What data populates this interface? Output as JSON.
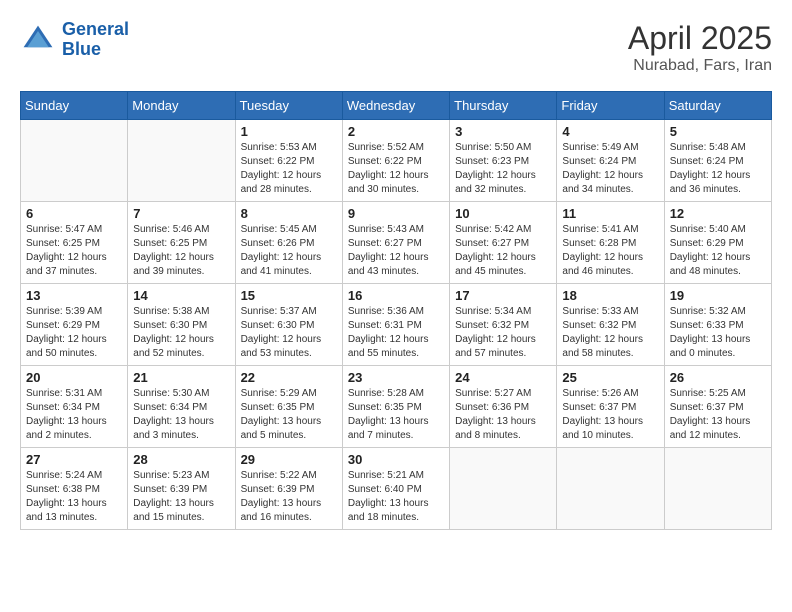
{
  "header": {
    "logo_line1": "General",
    "logo_line2": "Blue",
    "title": "April 2025",
    "subtitle": "Nurabad, Fars, Iran"
  },
  "days_of_week": [
    "Sunday",
    "Monday",
    "Tuesday",
    "Wednesday",
    "Thursday",
    "Friday",
    "Saturday"
  ],
  "weeks": [
    [
      {
        "day": "",
        "info": ""
      },
      {
        "day": "",
        "info": ""
      },
      {
        "day": "1",
        "info": "Sunrise: 5:53 AM\nSunset: 6:22 PM\nDaylight: 12 hours\nand 28 minutes."
      },
      {
        "day": "2",
        "info": "Sunrise: 5:52 AM\nSunset: 6:22 PM\nDaylight: 12 hours\nand 30 minutes."
      },
      {
        "day": "3",
        "info": "Sunrise: 5:50 AM\nSunset: 6:23 PM\nDaylight: 12 hours\nand 32 minutes."
      },
      {
        "day": "4",
        "info": "Sunrise: 5:49 AM\nSunset: 6:24 PM\nDaylight: 12 hours\nand 34 minutes."
      },
      {
        "day": "5",
        "info": "Sunrise: 5:48 AM\nSunset: 6:24 PM\nDaylight: 12 hours\nand 36 minutes."
      }
    ],
    [
      {
        "day": "6",
        "info": "Sunrise: 5:47 AM\nSunset: 6:25 PM\nDaylight: 12 hours\nand 37 minutes."
      },
      {
        "day": "7",
        "info": "Sunrise: 5:46 AM\nSunset: 6:25 PM\nDaylight: 12 hours\nand 39 minutes."
      },
      {
        "day": "8",
        "info": "Sunrise: 5:45 AM\nSunset: 6:26 PM\nDaylight: 12 hours\nand 41 minutes."
      },
      {
        "day": "9",
        "info": "Sunrise: 5:43 AM\nSunset: 6:27 PM\nDaylight: 12 hours\nand 43 minutes."
      },
      {
        "day": "10",
        "info": "Sunrise: 5:42 AM\nSunset: 6:27 PM\nDaylight: 12 hours\nand 45 minutes."
      },
      {
        "day": "11",
        "info": "Sunrise: 5:41 AM\nSunset: 6:28 PM\nDaylight: 12 hours\nand 46 minutes."
      },
      {
        "day": "12",
        "info": "Sunrise: 5:40 AM\nSunset: 6:29 PM\nDaylight: 12 hours\nand 48 minutes."
      }
    ],
    [
      {
        "day": "13",
        "info": "Sunrise: 5:39 AM\nSunset: 6:29 PM\nDaylight: 12 hours\nand 50 minutes."
      },
      {
        "day": "14",
        "info": "Sunrise: 5:38 AM\nSunset: 6:30 PM\nDaylight: 12 hours\nand 52 minutes."
      },
      {
        "day": "15",
        "info": "Sunrise: 5:37 AM\nSunset: 6:30 PM\nDaylight: 12 hours\nand 53 minutes."
      },
      {
        "day": "16",
        "info": "Sunrise: 5:36 AM\nSunset: 6:31 PM\nDaylight: 12 hours\nand 55 minutes."
      },
      {
        "day": "17",
        "info": "Sunrise: 5:34 AM\nSunset: 6:32 PM\nDaylight: 12 hours\nand 57 minutes."
      },
      {
        "day": "18",
        "info": "Sunrise: 5:33 AM\nSunset: 6:32 PM\nDaylight: 12 hours\nand 58 minutes."
      },
      {
        "day": "19",
        "info": "Sunrise: 5:32 AM\nSunset: 6:33 PM\nDaylight: 13 hours\nand 0 minutes."
      }
    ],
    [
      {
        "day": "20",
        "info": "Sunrise: 5:31 AM\nSunset: 6:34 PM\nDaylight: 13 hours\nand 2 minutes."
      },
      {
        "day": "21",
        "info": "Sunrise: 5:30 AM\nSunset: 6:34 PM\nDaylight: 13 hours\nand 3 minutes."
      },
      {
        "day": "22",
        "info": "Sunrise: 5:29 AM\nSunset: 6:35 PM\nDaylight: 13 hours\nand 5 minutes."
      },
      {
        "day": "23",
        "info": "Sunrise: 5:28 AM\nSunset: 6:35 PM\nDaylight: 13 hours\nand 7 minutes."
      },
      {
        "day": "24",
        "info": "Sunrise: 5:27 AM\nSunset: 6:36 PM\nDaylight: 13 hours\nand 8 minutes."
      },
      {
        "day": "25",
        "info": "Sunrise: 5:26 AM\nSunset: 6:37 PM\nDaylight: 13 hours\nand 10 minutes."
      },
      {
        "day": "26",
        "info": "Sunrise: 5:25 AM\nSunset: 6:37 PM\nDaylight: 13 hours\nand 12 minutes."
      }
    ],
    [
      {
        "day": "27",
        "info": "Sunrise: 5:24 AM\nSunset: 6:38 PM\nDaylight: 13 hours\nand 13 minutes."
      },
      {
        "day": "28",
        "info": "Sunrise: 5:23 AM\nSunset: 6:39 PM\nDaylight: 13 hours\nand 15 minutes."
      },
      {
        "day": "29",
        "info": "Sunrise: 5:22 AM\nSunset: 6:39 PM\nDaylight: 13 hours\nand 16 minutes."
      },
      {
        "day": "30",
        "info": "Sunrise: 5:21 AM\nSunset: 6:40 PM\nDaylight: 13 hours\nand 18 minutes."
      },
      {
        "day": "",
        "info": ""
      },
      {
        "day": "",
        "info": ""
      },
      {
        "day": "",
        "info": ""
      }
    ]
  ]
}
